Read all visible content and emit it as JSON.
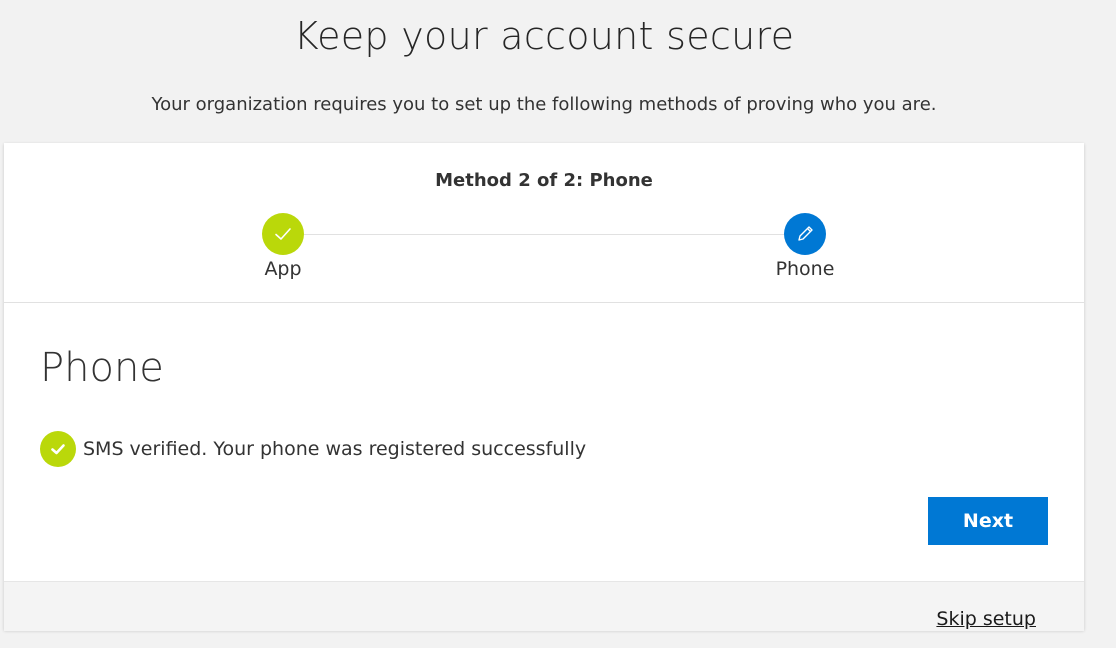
{
  "page": {
    "title": "Keep your account secure",
    "subtitle": "Your organization requires you to set up the following methods of proving who you are."
  },
  "progress": {
    "heading": "Method 2 of 2: Phone",
    "steps": [
      {
        "label": "App",
        "state": "completed",
        "icon": "checkmark-icon",
        "color": "#bad80a"
      },
      {
        "label": "Phone",
        "state": "current",
        "icon": "pencil-icon",
        "color": "#0078d4"
      }
    ]
  },
  "method": {
    "heading": "Phone",
    "status_icon": "check-circle-icon",
    "status_text": "SMS verified. Your phone was registered successfully"
  },
  "actions": {
    "next_label": "Next",
    "skip_label": "Skip setup"
  },
  "colors": {
    "accent": "#0078d4",
    "success": "#bad80a"
  }
}
